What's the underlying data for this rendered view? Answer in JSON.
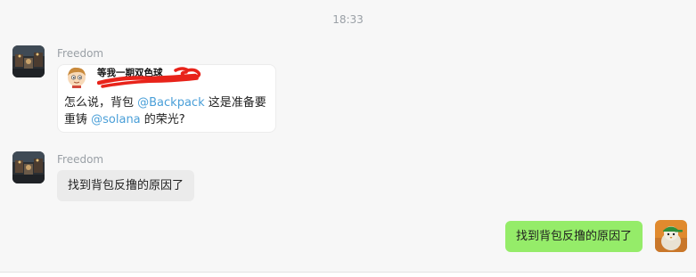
{
  "timestamp": "18:33",
  "messages": [
    {
      "sender": "Freedom",
      "card": {
        "username": "等我一期双色球",
        "text_prefix": "怎么说，背包 ",
        "mention_1": "@Backpack",
        "text_middle": " 这是准备要重铸 ",
        "mention_2": "@solana",
        "text_suffix": " 的荣光?"
      }
    },
    {
      "sender": "Freedom",
      "text": "找到背包反撸的原因了"
    },
    {
      "sender": "me",
      "text": "找到背包反撸的原因了"
    }
  ],
  "icons": {
    "sender_avatar": "night-street-photo-avatar-icon",
    "card_avatar": "cartoon-boy-avatar-icon",
    "self_avatar": "green-cap-bird-avatar-icon"
  },
  "colors": {
    "mention": "#4a9fd8",
    "outgoing_bubble": "#95ec69",
    "incoming_bubble": "#ebebeb",
    "redaction": "#e8231a"
  }
}
